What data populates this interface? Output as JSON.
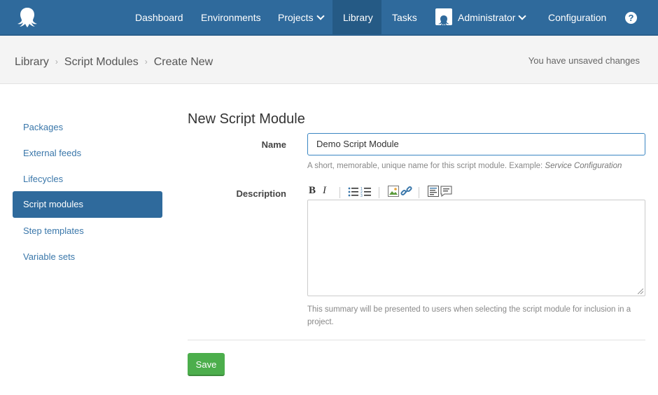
{
  "nav": {
    "items": [
      "Dashboard",
      "Environments",
      "Projects",
      "Library",
      "Tasks",
      "Administrator",
      "Configuration"
    ],
    "help": "?"
  },
  "breadcrumb": {
    "items": [
      "Library",
      "Script Modules",
      "Create New"
    ],
    "separator": "›"
  },
  "status": {
    "unsaved": "You have unsaved changes"
  },
  "sidebar": {
    "items": [
      "Packages",
      "External feeds",
      "Lifecycles",
      "Script modules",
      "Step templates",
      "Variable sets"
    ]
  },
  "form": {
    "title": "New Script Module",
    "name_label": "Name",
    "name_value": "Demo Script Module",
    "name_hint": "A short, memorable, unique name for this script module. Example: ",
    "name_hint_example": "Service Configuration",
    "description_label": "Description",
    "description_value": "",
    "description_hint_line1": "This summary will be presented to users when selecting the script module for inclusion in a",
    "description_hint_line2": "project.",
    "toolbar": {
      "bold": "B",
      "italic": "I"
    },
    "save_label": "Save"
  },
  "colors": {
    "nav": "#2f6a9c",
    "active": "#255a85",
    "save": "#4cae4c"
  }
}
